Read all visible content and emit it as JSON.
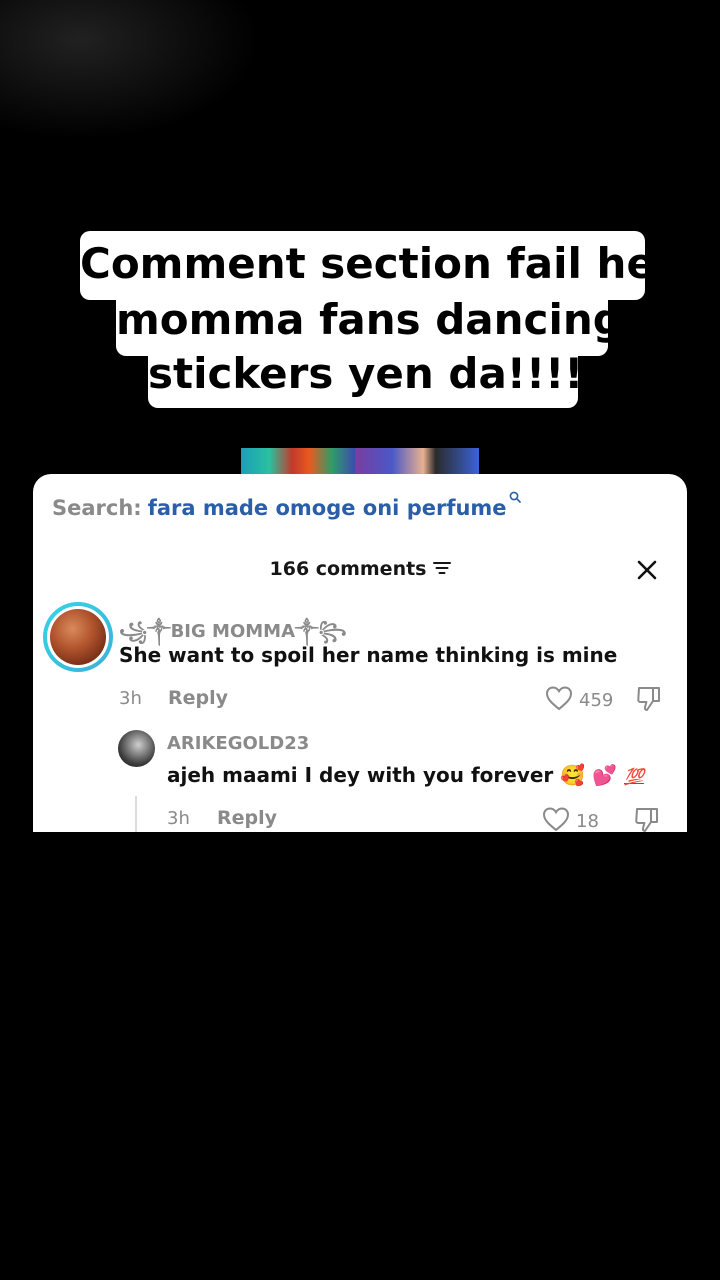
{
  "caption": {
    "line1": "Comment section fail her",
    "line2": "momma fans dancing",
    "line3": "stickers yen da!!!!!"
  },
  "search": {
    "label": "Search:",
    "query": "fara made omoge oni perfume"
  },
  "comments_header": {
    "count_text": "166 comments"
  },
  "comments": [
    {
      "username": "꧁༒BIG MOMMA༒꧂",
      "text": "She want to spoil her name thinking is mine",
      "time": "3h",
      "reply_label": "Reply",
      "likes": "459"
    },
    {
      "username": "ARIKEGOLD23",
      "text": "ajeh maami I dey with you forever",
      "emojis": [
        "🥰",
        "💕",
        "💯"
      ],
      "time": "3h",
      "reply_label": "Reply",
      "likes": "18"
    }
  ],
  "icons": {
    "search": "search-icon",
    "filter": "filter-icon",
    "close": "close-icon",
    "like": "heart-icon",
    "dislike": "thumbs-down-icon"
  },
  "colors": {
    "background": "#000000",
    "panel": "#ffffff",
    "search_query": "#2a5ea8",
    "muted": "#8a8a8a",
    "avatar_ring": "#35d6e6"
  }
}
